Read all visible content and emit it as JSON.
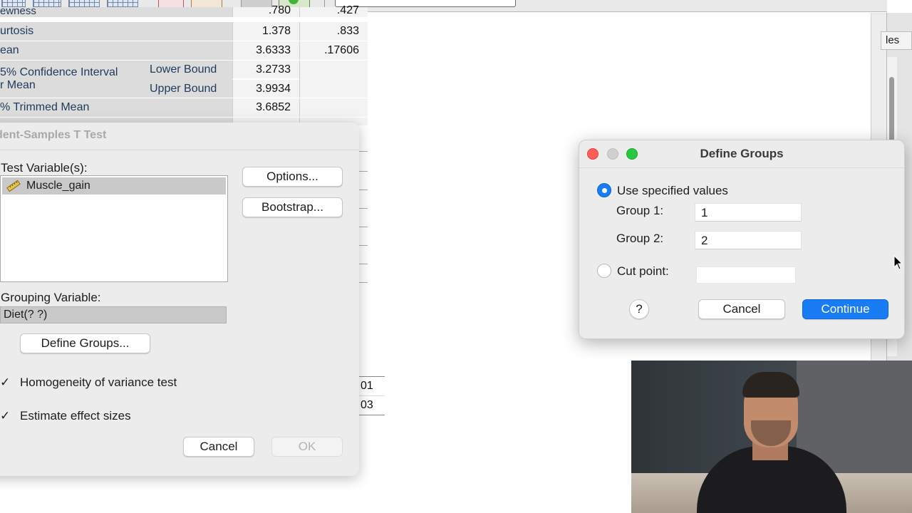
{
  "stats_table": {
    "rows": [
      {
        "label": "ewness",
        "v1": ".780",
        "v2": ".427"
      },
      {
        "label": "urtosis",
        "v1": "1.378",
        "v2": ".833"
      },
      {
        "label": "ean",
        "v1": "3.6333",
        "v2": ".17606"
      },
      {
        "label": "5% Confidence Interval",
        "label2": "r Mean",
        "sub1": "Lower Bound",
        "v1": "3.2733",
        "sub2": "Upper Bound",
        "v1b": "3.9934"
      },
      {
        "label": "% Trimmed Mean",
        "v1": "3.6852",
        "v2": ""
      }
    ]
  },
  "lower_table": {
    "cells": [
      "01",
      "03"
    ]
  },
  "right_tab": {
    "label": "les"
  },
  "ttest_dialog": {
    "title": "dent-Samples T Test",
    "test_variables_label": "Test Variable(s):",
    "test_variables": [
      "Muscle_gain"
    ],
    "options_button": "Options...",
    "bootstrap_button": "Bootstrap...",
    "grouping_variable_label": "Grouping Variable:",
    "grouping_variable_value": "Diet(? ?)",
    "define_groups_button": "Define Groups...",
    "homogeneity_label": "Homogeneity of variance test",
    "effect_sizes_label": "Estimate effect sizes",
    "checkmark": "✓",
    "cancel_button": "Cancel",
    "ok_button": "OK"
  },
  "define_groups_dialog": {
    "title": "Define Groups",
    "use_specified_label": "Use specified values",
    "group1_label": "Group 1:",
    "group1_value": "1",
    "group2_label": "Group 2:",
    "group2_value": "2",
    "cut_point_label": "Cut point:",
    "cut_point_value": "",
    "help_button": "?",
    "cancel_button": "Cancel",
    "continue_button": "Continue",
    "selected_option": "use_specified_values"
  },
  "colors": {
    "accent": "#1a7cf5",
    "close": "#fe5f57",
    "minimize_disabled": "#cfcfcf",
    "zoom": "#28c840"
  }
}
